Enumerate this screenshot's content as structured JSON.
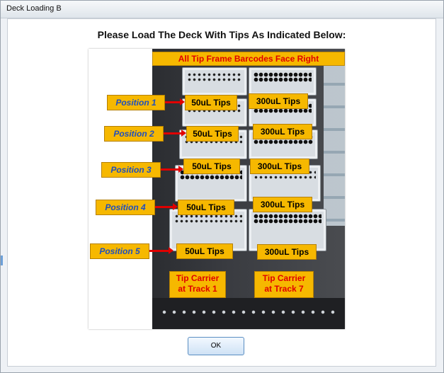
{
  "window": {
    "title": "Deck Loading B"
  },
  "dialog": {
    "heading": "Please Load The Deck With Tips As Indicated Below:",
    "ok_label": "OK"
  },
  "photo": {
    "banner": "All Tip Frame Barcodes Face Right",
    "positions": [
      {
        "label": "Position 1",
        "left_tips": "50uL Tips",
        "right_tips": "300uL Tips"
      },
      {
        "label": "Position 2",
        "left_tips": "50uL Tips",
        "right_tips": "300uL Tips"
      },
      {
        "label": "Position 3",
        "left_tips": "50uL Tips",
        "right_tips": "300uL Tips"
      },
      {
        "label": "Position 4",
        "left_tips": "50uL Tips",
        "right_tips": "300uL Tips"
      },
      {
        "label": "Position 5",
        "left_tips": "50uL Tips",
        "right_tips": "300uL Tips"
      }
    ],
    "carriers": [
      {
        "line1": "Tip Carrier",
        "line2": "at Track 1"
      },
      {
        "line1": "Tip Carrier",
        "line2": "at Track 7"
      }
    ]
  },
  "colors": {
    "label_yellow": "#f6b800",
    "arrow_red": "#e00000",
    "position_text_blue": "#1f4fbf",
    "ok_button_border": "#5a8ec2"
  }
}
